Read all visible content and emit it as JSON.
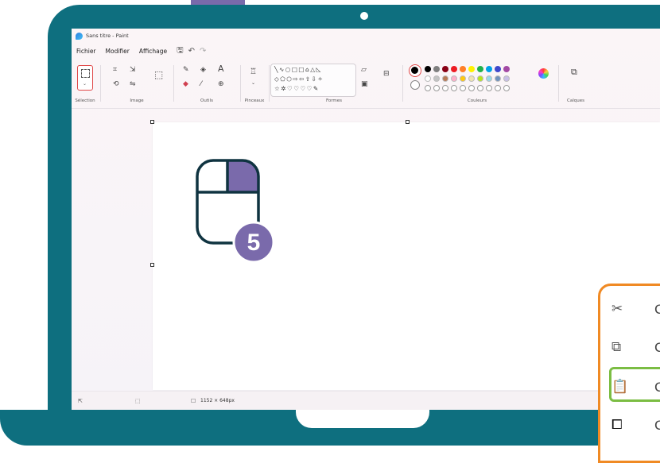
{
  "window": {
    "title": "Sans titre - Paint"
  },
  "menu": {
    "items": [
      "Fichier",
      "Modifier",
      "Affichage"
    ]
  },
  "ribbon": {
    "groups": {
      "selection": "Sélection",
      "image": "Image",
      "outils": "Outils",
      "pinceaux": "Pinceaux",
      "formes": "Formes",
      "couleurs": "Couleurs",
      "calques": "Calques"
    },
    "shape_rows": [
      "╲∿○□□⌂△◺",
      "◇⬠⬡⇨⇦⇧⇩✧",
      "☆✲♡♡♡♡✎"
    ],
    "colors_row1": [
      "#000000",
      "#7f7f7f",
      "#880015",
      "#ed1c24",
      "#ff7f27",
      "#fff200",
      "#22b14c",
      "#00a2e8",
      "#3f48cc",
      "#a349a4"
    ],
    "colors_row2": [
      "#ffffff",
      "#c3c3c3",
      "#b97a57",
      "#ffaec9",
      "#ffc90e",
      "#efe4b0",
      "#b5e61d",
      "#99d9ea",
      "#7092be",
      "#c8bfe7"
    ]
  },
  "status": {
    "canvas_size": "1152 × 648px"
  },
  "illustration": {
    "step_number": "5",
    "accent_color": "#7a6aab",
    "outline_color": "#0f3340"
  },
  "context_menu": {
    "items": [
      "scissors-icon",
      "copy-icon",
      "paste-icon",
      "paste-from-icon"
    ],
    "labels": [
      "C",
      "C",
      "C",
      "C"
    ]
  }
}
